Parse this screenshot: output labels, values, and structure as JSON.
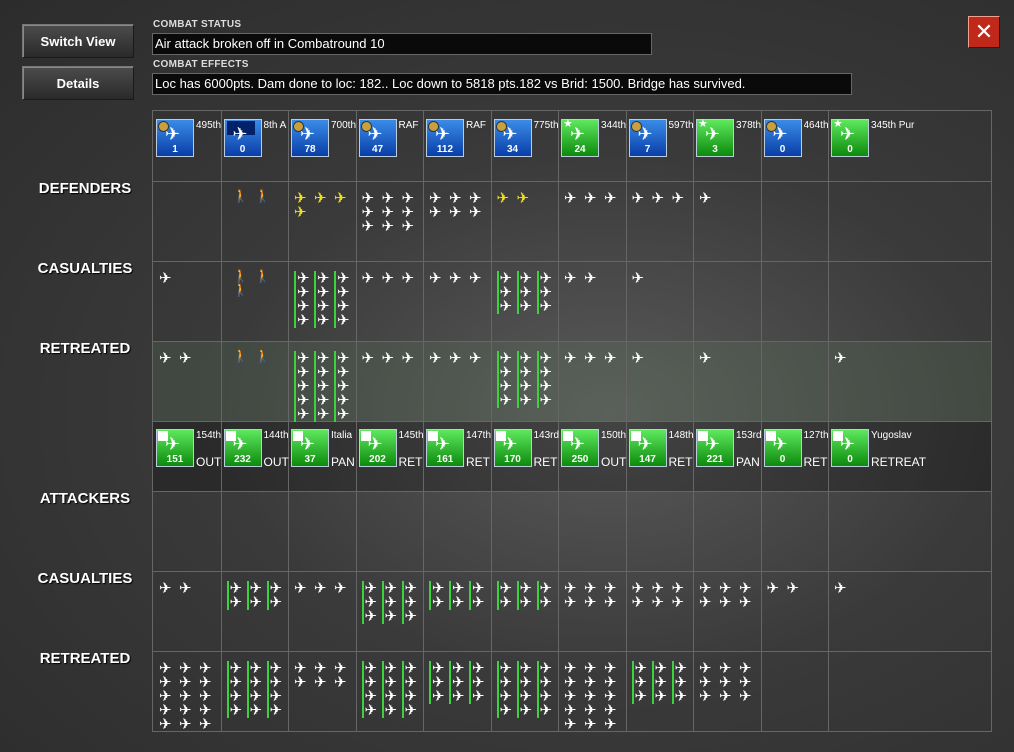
{
  "buttons": {
    "switch_view": "Switch View",
    "details": "Details",
    "close": "✕"
  },
  "combat_status": {
    "label": "COMBAT STATUS",
    "text": "Air attack broken off in Combatround  10"
  },
  "combat_effects": {
    "label": "COMBAT EFFECTS",
    "text": "Loc has  6000pts. Dam done to loc: 182.. Loc down to 5818 pts.182 vs Brid: 1500. Bridge has survived."
  },
  "rows": {
    "defenders": "DEFENDERS",
    "def_casualties": "CASUALTIES",
    "def_retreated": "RETREATED",
    "attackers": "ATTACKERS",
    "att_casualties": "CASUALTIES",
    "att_retreated": "RETREATED"
  },
  "defender_units": [
    {
      "name": "495th",
      "count": "1",
      "color": "blue",
      "mark": "badge"
    },
    {
      "name": "8th A",
      "count": "0",
      "color": "blue",
      "mark": "flag"
    },
    {
      "name": "700th",
      "count": "78",
      "color": "blue",
      "mark": "badge"
    },
    {
      "name": "RAF",
      "count": "47",
      "color": "blue",
      "mark": "badge"
    },
    {
      "name": "RAF",
      "count": "112",
      "color": "blue",
      "mark": "badge"
    },
    {
      "name": "775th",
      "count": "34",
      "color": "blue",
      "mark": "badge"
    },
    {
      "name": "344th",
      "count": "24",
      "color": "green",
      "mark": "star"
    },
    {
      "name": "597th",
      "count": "7",
      "color": "blue",
      "mark": "badge"
    },
    {
      "name": "378th",
      "count": "3",
      "color": "green",
      "mark": "star"
    },
    {
      "name": "464th",
      "count": "0",
      "color": "blue",
      "mark": "badge"
    },
    {
      "name": "345th Pur",
      "count": "0",
      "color": "green",
      "mark": "star"
    }
  ],
  "attacker_units": [
    {
      "name": "154th",
      "count": "151",
      "status": "OUT"
    },
    {
      "name": "144th",
      "count": "232",
      "status": "OUT"
    },
    {
      "name": "Italia",
      "count": "37",
      "status": "PAN"
    },
    {
      "name": "145th",
      "count": "202",
      "status": "RET"
    },
    {
      "name": "147th",
      "count": "161",
      "status": "RET"
    },
    {
      "name": "143rd",
      "count": "170",
      "status": "RET"
    },
    {
      "name": "150th",
      "count": "250",
      "status": "OUT"
    },
    {
      "name": "148th",
      "count": "147",
      "status": "RET"
    },
    {
      "name": "153rd",
      "count": "221",
      "status": "PAN"
    },
    {
      "name": "127th",
      "count": "0",
      "status": "RET"
    },
    {
      "name": "Yugoslav",
      "count": "0",
      "status": "RETREAT"
    }
  ],
  "icons": {
    "plane": "plane-icon",
    "infantry": "infantry-icon",
    "close": "close-icon"
  },
  "colors": {
    "blue_unit": "#1a5ccc",
    "green_unit": "#22b022",
    "close_red": "#c0281a",
    "highlight_plane": "#f0e020"
  }
}
